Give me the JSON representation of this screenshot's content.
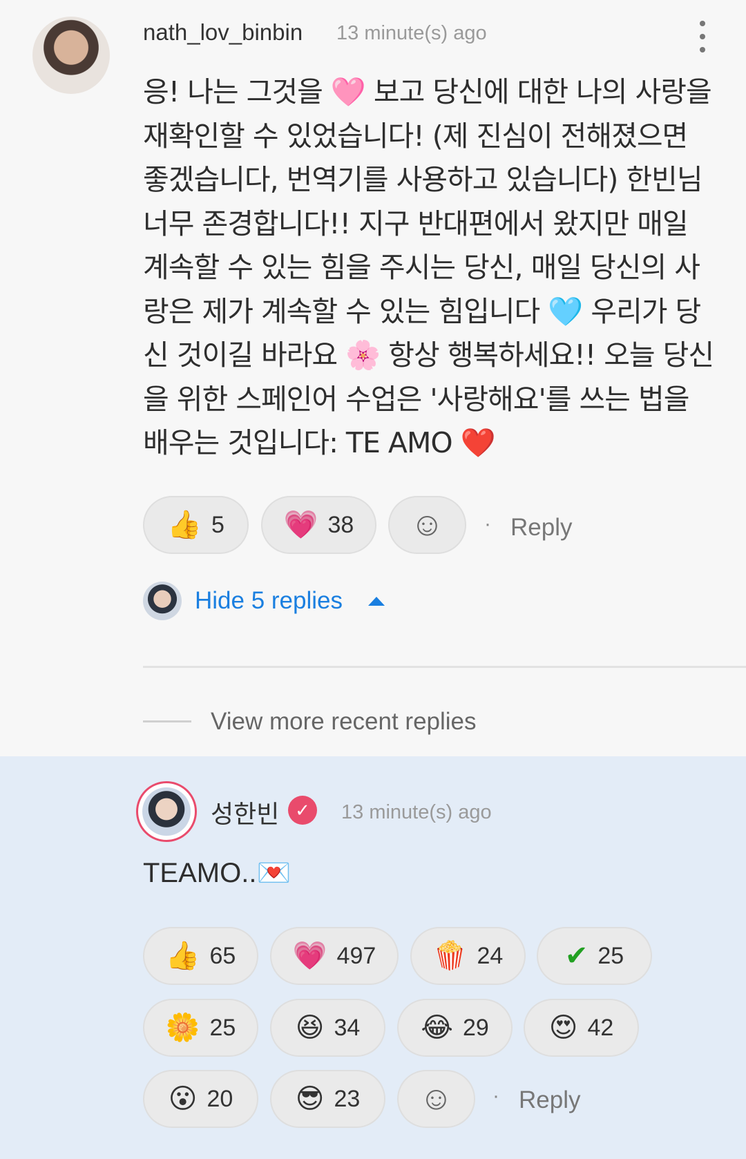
{
  "comment": {
    "username": "nath_lov_binbin",
    "timestamp": "13 minute(s) ago",
    "body_lines": [
      "응! 나는 그것을 🩷 보고 당신에 대한 나의 사랑을",
      "재확인할 수 있었습니다! (제 진심이 전해졌으면",
      "좋겠습니다, 번역기를 사용하고 있습니다) 한빈님",
      "너무 존경합니다!! 지구 반대편에서 왔지만 매일",
      "계속할 수 있는 힘을 주시는 당신, 매일 당신의 사",
      "랑은 제가 계속할 수 있는 힘입니다 🩵 우리가 당",
      "신 것이길 바라요 🌸 항상 행복하세요!! 오늘 당신",
      "을 위한 스페인어 수업은 '사랑해요'를 쓰는 법을",
      "배우는 것입니다: TE AMO ❤️"
    ],
    "reactions": [
      {
        "icon": "👍",
        "count": "5"
      },
      {
        "icon": "💗",
        "count": "38"
      }
    ],
    "add_reaction_icon": "☺",
    "reply_label": "Reply",
    "hide_replies_label": "Hide 5 replies",
    "view_more_label": "View more recent replies"
  },
  "reply": {
    "username": "성한빈",
    "verified_icon": "✓",
    "timestamp": "13 minute(s) ago",
    "text": "TEAMO..💌",
    "reactions": [
      {
        "icon": "👍",
        "count": "65"
      },
      {
        "icon": "💗",
        "count": "497"
      },
      {
        "icon": "🍿",
        "count": "24"
      },
      {
        "icon": "✔",
        "count": "25"
      },
      {
        "icon": "🌼",
        "count": "25"
      },
      {
        "icon": "😆",
        "count": "34"
      },
      {
        "icon": "😂",
        "count": "29"
      },
      {
        "icon": "😍",
        "count": "42"
      },
      {
        "icon": "😮",
        "count": "20"
      },
      {
        "icon": "😎",
        "count": "23"
      }
    ],
    "add_reaction_icon": "☺",
    "reply_label": "Reply"
  },
  "colors": {
    "link_blue": "#1a7fe0",
    "verified_red": "#e94b6c",
    "reply_bg": "#e3ecf7"
  }
}
